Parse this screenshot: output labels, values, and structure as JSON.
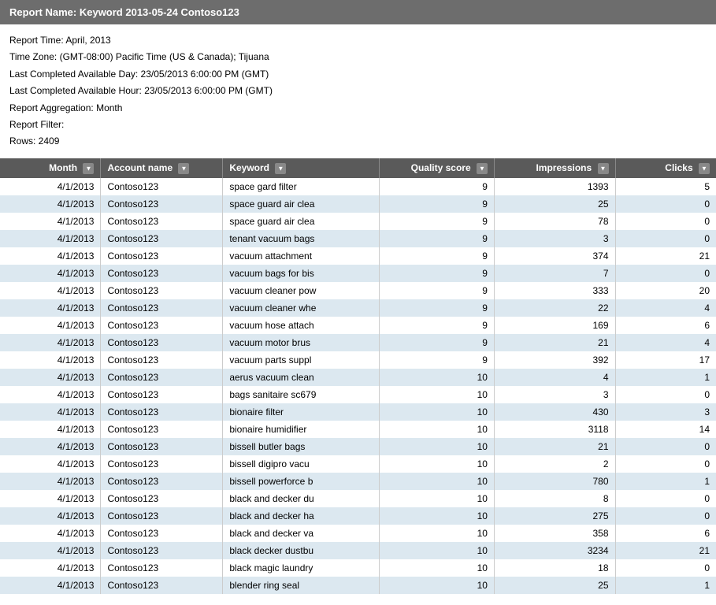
{
  "report": {
    "title": "Report Name: Keyword 2013-05-24 Contoso123",
    "meta": {
      "time": "Report Time: April, 2013",
      "timezone": "Time Zone: (GMT-08:00) Pacific Time (US & Canada); Tijuana",
      "last_completed_day": "Last Completed Available Day: 23/05/2013 6:00:00 PM (GMT)",
      "last_completed_hour": "Last Completed Available Hour: 23/05/2013 6:00:00 PM (GMT)",
      "aggregation": "Report Aggregation: Month",
      "filter": "Report Filter:",
      "rows": "Rows: 2409"
    },
    "columns": [
      {
        "id": "month",
        "label": "Month"
      },
      {
        "id": "account",
        "label": "Account name"
      },
      {
        "id": "keyword",
        "label": "Keyword"
      },
      {
        "id": "quality",
        "label": "Quality score"
      },
      {
        "id": "impressions",
        "label": "Impressions"
      },
      {
        "id": "clicks",
        "label": "Clicks"
      }
    ],
    "rows": [
      {
        "month": "4/1/2013",
        "account": "Contoso123",
        "keyword": "space gard filter",
        "quality": 9,
        "impressions": 1393,
        "clicks": 5
      },
      {
        "month": "4/1/2013",
        "account": "Contoso123",
        "keyword": "space guard air clea",
        "quality": 9,
        "impressions": 25,
        "clicks": 0
      },
      {
        "month": "4/1/2013",
        "account": "Contoso123",
        "keyword": "space guard air clea",
        "quality": 9,
        "impressions": 78,
        "clicks": 0
      },
      {
        "month": "4/1/2013",
        "account": "Contoso123",
        "keyword": "tenant vacuum bags",
        "quality": 9,
        "impressions": 3,
        "clicks": 0
      },
      {
        "month": "4/1/2013",
        "account": "Contoso123",
        "keyword": "vacuum attachment",
        "quality": 9,
        "impressions": 374,
        "clicks": 21
      },
      {
        "month": "4/1/2013",
        "account": "Contoso123",
        "keyword": "vacuum bags for bis",
        "quality": 9,
        "impressions": 7,
        "clicks": 0
      },
      {
        "month": "4/1/2013",
        "account": "Contoso123",
        "keyword": "vacuum cleaner pow",
        "quality": 9,
        "impressions": 333,
        "clicks": 20
      },
      {
        "month": "4/1/2013",
        "account": "Contoso123",
        "keyword": "vacuum cleaner whe",
        "quality": 9,
        "impressions": 22,
        "clicks": 4
      },
      {
        "month": "4/1/2013",
        "account": "Contoso123",
        "keyword": "vacuum hose attach",
        "quality": 9,
        "impressions": 169,
        "clicks": 6
      },
      {
        "month": "4/1/2013",
        "account": "Contoso123",
        "keyword": "vacuum motor brus",
        "quality": 9,
        "impressions": 21,
        "clicks": 4
      },
      {
        "month": "4/1/2013",
        "account": "Contoso123",
        "keyword": "vacuum parts suppl",
        "quality": 9,
        "impressions": 392,
        "clicks": 17
      },
      {
        "month": "4/1/2013",
        "account": "Contoso123",
        "keyword": "aerus vacuum clean",
        "quality": 10,
        "impressions": 4,
        "clicks": 1
      },
      {
        "month": "4/1/2013",
        "account": "Contoso123",
        "keyword": "bags sanitaire sc679",
        "quality": 10,
        "impressions": 3,
        "clicks": 0
      },
      {
        "month": "4/1/2013",
        "account": "Contoso123",
        "keyword": "bionaire filter",
        "quality": 10,
        "impressions": 430,
        "clicks": 3
      },
      {
        "month": "4/1/2013",
        "account": "Contoso123",
        "keyword": "bionaire humidifier",
        "quality": 10,
        "impressions": 3118,
        "clicks": 14
      },
      {
        "month": "4/1/2013",
        "account": "Contoso123",
        "keyword": "bissell butler bags",
        "quality": 10,
        "impressions": 21,
        "clicks": 0
      },
      {
        "month": "4/1/2013",
        "account": "Contoso123",
        "keyword": "bissell digipro vacu",
        "quality": 10,
        "impressions": 2,
        "clicks": 0
      },
      {
        "month": "4/1/2013",
        "account": "Contoso123",
        "keyword": "bissell powerforce b",
        "quality": 10,
        "impressions": 780,
        "clicks": 1
      },
      {
        "month": "4/1/2013",
        "account": "Contoso123",
        "keyword": "black and decker du",
        "quality": 10,
        "impressions": 8,
        "clicks": 0
      },
      {
        "month": "4/1/2013",
        "account": "Contoso123",
        "keyword": "black and decker ha",
        "quality": 10,
        "impressions": 275,
        "clicks": 0
      },
      {
        "month": "4/1/2013",
        "account": "Contoso123",
        "keyword": "black and decker va",
        "quality": 10,
        "impressions": 358,
        "clicks": 6
      },
      {
        "month": "4/1/2013",
        "account": "Contoso123",
        "keyword": "black decker dustbu",
        "quality": 10,
        "impressions": 3234,
        "clicks": 21
      },
      {
        "month": "4/1/2013",
        "account": "Contoso123",
        "keyword": "black magic laundry",
        "quality": 10,
        "impressions": 18,
        "clicks": 0
      },
      {
        "month": "4/1/2013",
        "account": "Contoso123",
        "keyword": "blender ring seal",
        "quality": 10,
        "impressions": 25,
        "clicks": 1
      }
    ]
  }
}
